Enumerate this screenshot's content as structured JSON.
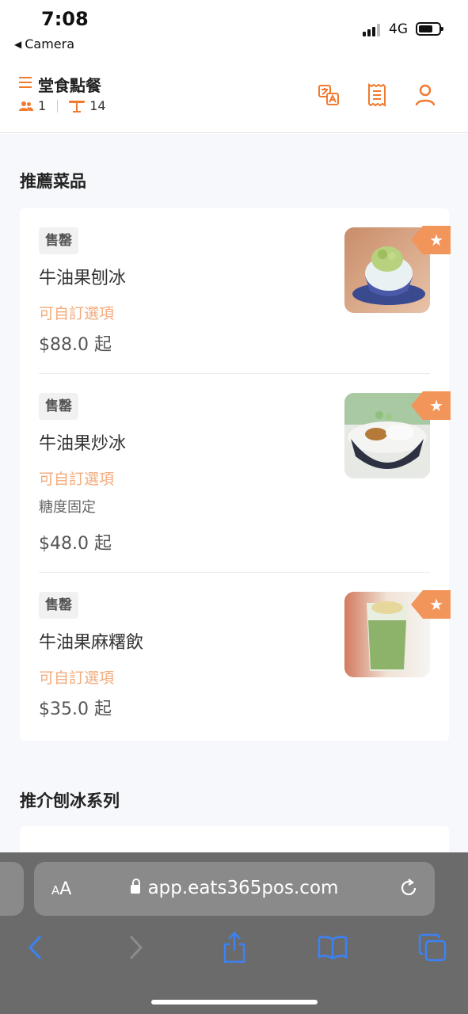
{
  "status_bar": {
    "time": "7:08",
    "back_label": "Camera",
    "network": "4G"
  },
  "header": {
    "title": "堂食點餐",
    "guest_count": "1",
    "table_number": "14",
    "icons": [
      "translate-icon",
      "receipt-icon",
      "user-icon"
    ]
  },
  "sections": [
    {
      "title": "推薦菜品",
      "items": [
        {
          "badge": "售罄",
          "name": "牛油果刨冰",
          "custom": "可自訂選項",
          "note": "",
          "price": "$88.0 起"
        },
        {
          "badge": "售罄",
          "name": "牛油果炒冰",
          "custom": "可自訂選項",
          "note": "糖度固定",
          "price": "$48.0 起"
        },
        {
          "badge": "售罄",
          "name": "牛油果麻糬飲",
          "custom": "可自訂選項",
          "note": "",
          "price": "$35.0 起"
        }
      ]
    },
    {
      "title": "推介刨冰系列"
    }
  ],
  "browser": {
    "text_size_label_small": "A",
    "text_size_label": "A",
    "url": "app.eats365pos.com"
  },
  "colors": {
    "accent": "#f07a2e",
    "custom_text": "#f3ab7c",
    "star_badge": "#f2955a",
    "browser_bar": "#6b6b6b"
  }
}
